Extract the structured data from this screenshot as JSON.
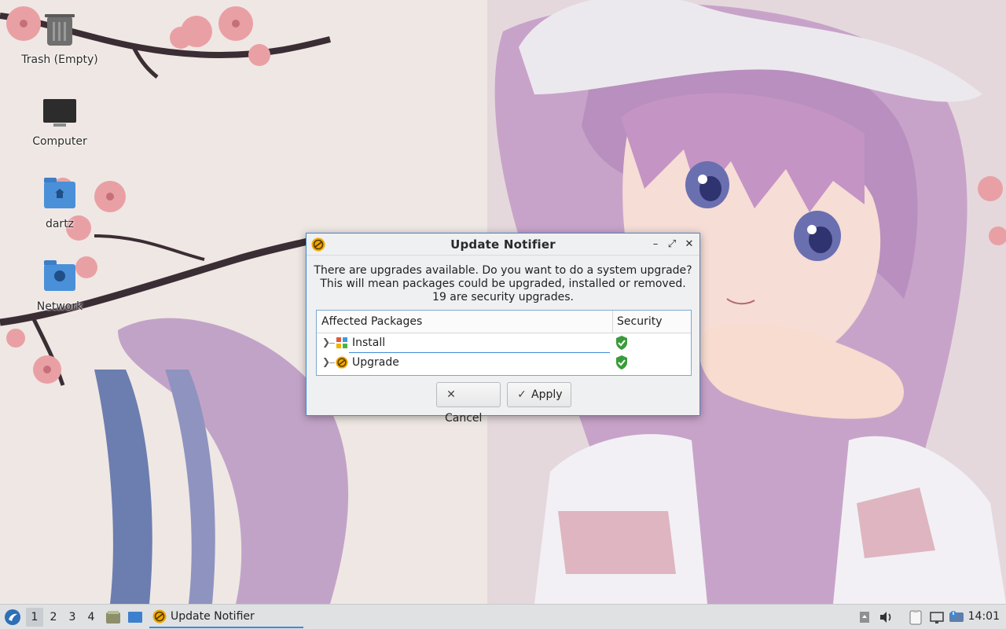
{
  "desktop": {
    "icons": [
      {
        "label": "Trash (Empty)",
        "icon": "trash-icon"
      },
      {
        "label": "Computer",
        "icon": "computer-icon"
      },
      {
        "label": "dartz",
        "icon": "home-folder-icon"
      },
      {
        "label": "Network",
        "icon": "network-folder-icon"
      }
    ]
  },
  "dialog": {
    "title": "Update Notifier",
    "controls": {
      "minimize": "–",
      "maximize": "⤢",
      "close": "✕"
    },
    "message_lines": [
      "There are upgrades available. Do you want to do a system upgrade?",
      "This will mean packages could be upgraded, installed or removed.",
      "19 are security upgrades."
    ],
    "tree": {
      "columns": [
        "Affected Packages",
        "Security"
      ],
      "rows": [
        {
          "label": "Install",
          "icon": "install-icon",
          "security": "shield-check-icon"
        },
        {
          "label": "Upgrade",
          "icon": "upgrade-icon",
          "security": "shield-check-icon"
        }
      ]
    },
    "buttons": {
      "cancel": "Cancel",
      "apply": "Apply"
    }
  },
  "taskbar": {
    "workspaces": [
      "1",
      "2",
      "3",
      "4"
    ],
    "active_workspace": "1",
    "task": {
      "label": "Update Notifier",
      "icon": "update-notifier-icon"
    },
    "clock": "14:01"
  },
  "colors": {
    "accent": "#3f8ad6",
    "shield": "#3a9b3a",
    "update_icon": "#f0a800",
    "folder": "#4a90d9"
  }
}
